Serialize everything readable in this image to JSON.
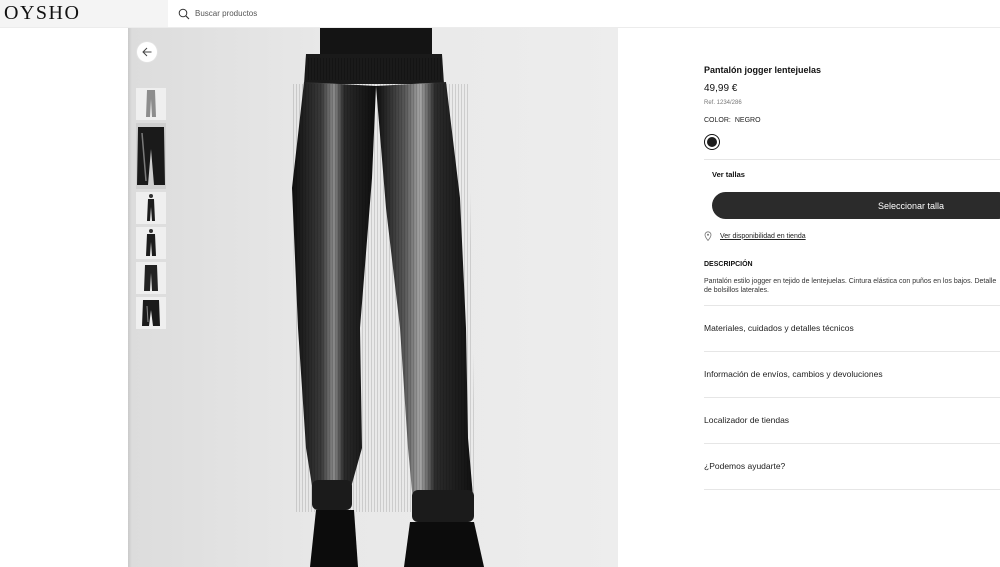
{
  "header": {
    "logo": "OYSHO",
    "search_placeholder": "Buscar productos"
  },
  "gallery": {
    "thumbnails": [
      "thumb-1",
      "thumb-2",
      "thumb-3",
      "thumb-4",
      "thumb-5",
      "thumb-6"
    ],
    "active_thumbnail": 2
  },
  "product": {
    "title": "Pantalón jogger lentejuelas",
    "price": "49,99 €",
    "ref": "Ref. 1234/286",
    "color_label": "COLOR:",
    "color_value": "NEGRO",
    "swatch_color": "#1c1c1c",
    "sizes_link": "Ver tallas",
    "select_size_label": "Seleccionar talla",
    "store_availability": "Ver disponibilidad en tienda",
    "description_title": "DESCRIPCIÓN",
    "description_text": "Pantalón estilo jogger en tejido de lentejuelas. Cintura elástica con puños en los bajos. Detalle de bolsillos laterales."
  },
  "accordion": [
    {
      "label": "Materiales, cuidados y detalles técnicos"
    },
    {
      "label": "Información de envíos, cambios y devoluciones"
    },
    {
      "label": "Localizador de tiendas"
    },
    {
      "label": "¿Podemos ayudarte?"
    }
  ],
  "colors": {
    "button_bg": "#2b2b2b",
    "header_bg": "#f4f4f4",
    "gallery_bg": "#e8e8e8"
  }
}
